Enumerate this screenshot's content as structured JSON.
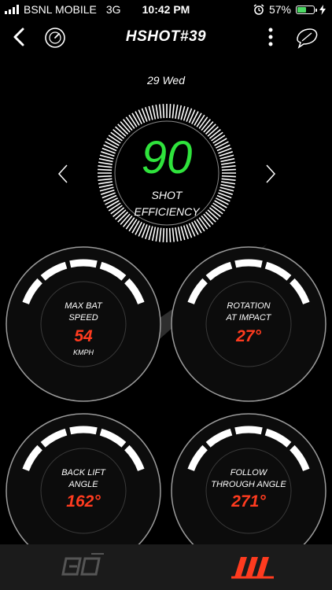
{
  "status": {
    "carrier": "BSNL MOBILE",
    "network": "3G",
    "time": "10:42 PM",
    "battery": "57%",
    "battery_level": 0.57
  },
  "header": {
    "title": "HSHOT#39"
  },
  "date": "29 Wed",
  "efficiency": {
    "value": "90",
    "label_line1": "SHOT",
    "label_line2": "EFFICIENCY"
  },
  "gauges": [
    {
      "label_line1": "MAX BAT",
      "label_line2": "SPEED",
      "value": "54",
      "unit": "KMPH"
    },
    {
      "label_line1": "ROTATION",
      "label_line2": "AT IMPACT",
      "value": "27°"
    },
    {
      "label_line1": "BACK LIFT",
      "label_line2": "ANGLE",
      "value": "162°"
    },
    {
      "label_line1": "FOLLOW",
      "label_line2": "THROUGH ANGLE",
      "value": "271°"
    }
  ],
  "colors": {
    "accent_green": "#2fe33c",
    "accent_red": "#ff3b1f",
    "tabbar": "#1b1b1b"
  },
  "icons": {
    "nav": [
      "back-icon",
      "gauge-icon",
      "more-icon",
      "feather-icon"
    ],
    "tabs": [
      "3d-view-icon",
      "stats-bars-icon"
    ]
  }
}
